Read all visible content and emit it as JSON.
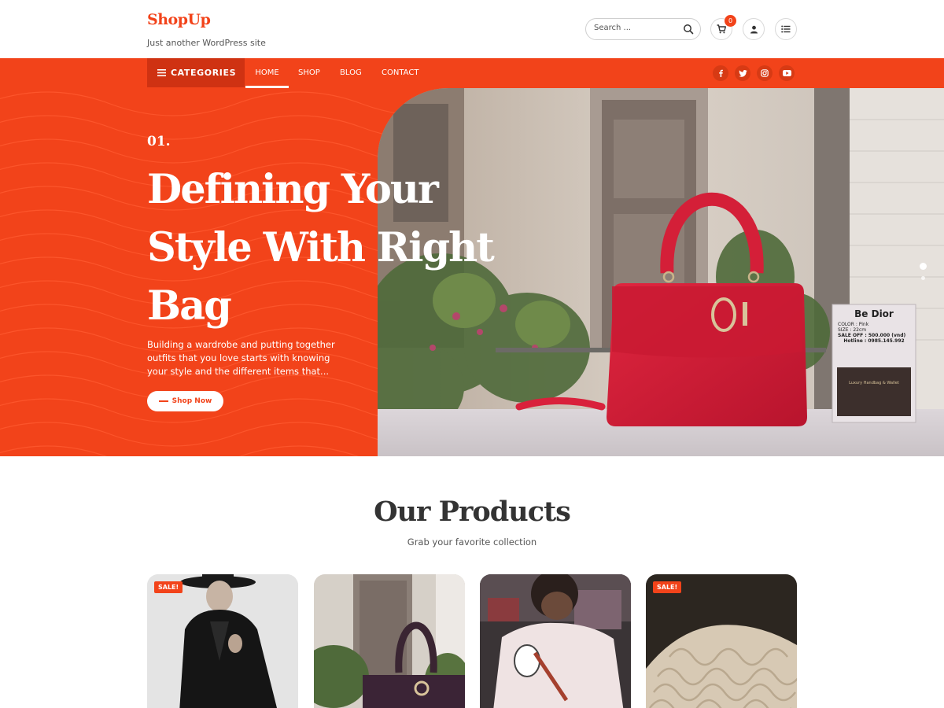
{
  "header": {
    "site_title": "ShopUp",
    "tagline": "Just another WordPress site",
    "search_placeholder": "Search ...",
    "cart_count": "0"
  },
  "nav": {
    "categories_label": "CATEGORIES",
    "links": [
      "HOME",
      "SHOP",
      "BLOG",
      "CONTACT"
    ],
    "active": "HOME",
    "social_icons": [
      "facebook-icon",
      "twitter-icon",
      "instagram-icon",
      "youtube-icon"
    ]
  },
  "hero": {
    "number": "01.",
    "title_lines": [
      "Defining Your",
      "Style With Right",
      "Bag"
    ],
    "description": "Building a wardrobe and putting together outfits that you love starts with knowing your style and the different items that...",
    "cta_label": "Shop Now",
    "slides_count": 2,
    "active_slide": 1,
    "display_card": {
      "heading": "Be Dior",
      "lines": [
        "COLOR    : Pink",
        "SIZE       : 22cm",
        "SALE OFF : 500.000 (vnd)",
        "Hotline : 0985.145.992"
      ],
      "footer": "Luxury Handbag & Wallet"
    }
  },
  "products": {
    "title": "Our Products",
    "subtitle": "Grab your favorite collection",
    "items": [
      {
        "sale_label": "SALE!",
        "on_sale": true
      },
      {
        "sale_label": "",
        "on_sale": false
      },
      {
        "sale_label": "",
        "on_sale": false
      },
      {
        "sale_label": "SALE!",
        "on_sale": true
      }
    ]
  },
  "colors": {
    "accent": "#f2431a",
    "accent_dark": "#cf3212",
    "text": "#333333"
  }
}
